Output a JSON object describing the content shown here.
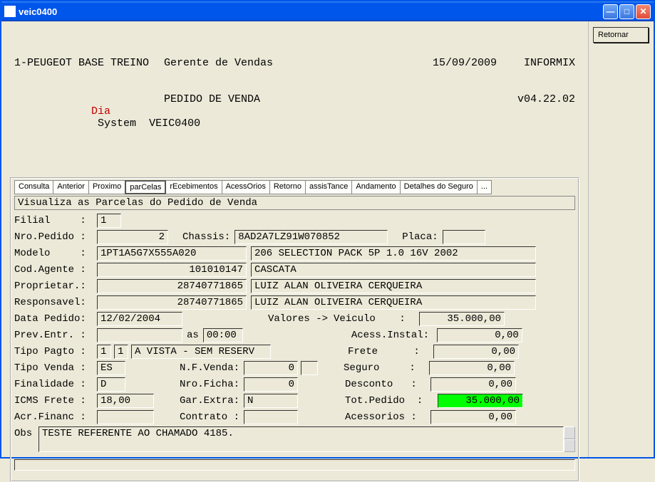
{
  "window": {
    "title": "veic0400"
  },
  "header": {
    "org": "1-PEUGEOT BASE TREINO",
    "role": "Gerente de Vendas",
    "date": "15/09/2009",
    "db": "INFORMIX",
    "dia": "Dia",
    "system_lbl": "System",
    "system_code": "VEIC0400",
    "screen_title": "PEDIDO DE VENDA",
    "version": "v04.22.02"
  },
  "tabs": {
    "consulta": "Consulta",
    "anterior": "Anterior",
    "proximo": "Proximo",
    "parcelas": "parCelas",
    "recebimentos": "rEcebimentos",
    "acessorios": "AcessOrios",
    "retorno": "Retorno",
    "assistance": "assisTance",
    "andamento": "Andamento",
    "detalhes": "Detalhes do Seguro",
    "more": "..."
  },
  "desc": "Visualiza as Parcelas do Pedido de Venda",
  "labels": {
    "filial": "Filial     :",
    "nro_pedido": "Nro.Pedido :",
    "chassis": "Chassis:",
    "placa": "Placa:",
    "modelo": "Modelo     :",
    "cod_agente": "Cod.Agente :",
    "proprietar": "Proprietar.:",
    "responsavel": "Responsavel:",
    "data_pedido": "Data Pedido:",
    "valores": "Valores ->",
    "veiculo": "Veiculo    :",
    "prev_entr": "Prev.Entr. :",
    "as": "as",
    "acess_instal": "Acess.Instal:",
    "tipo_pagto": "Tipo Pagto :",
    "frete": "Frete      :",
    "tipo_venda": "Tipo Venda :",
    "nf_venda": "N.F.Venda:",
    "seguro": "Seguro     :",
    "finalidade": "Finalidade :",
    "nro_ficha": "Nro.Ficha:",
    "desconto": "Desconto   :",
    "icms_frete": "ICMS Frete :",
    "gar_extra": "Gar.Extra:",
    "tot_pedido": "Tot.Pedido  :",
    "acr_financ": "Acr.Financ :",
    "contrato": "Contrato :",
    "acessorios": "Acessorios :",
    "obs": "Obs"
  },
  "values": {
    "filial": "1",
    "nro_pedido": "2",
    "chassis": "8AD2A7LZ91W070852",
    "placa": "",
    "modelo_code": "1PT1A5G7X555A020",
    "modelo_desc": "206 SELECTION PACK 5P 1.0 16V 2002",
    "cod_agente": "101010147",
    "agente_name": "CASCATA",
    "proprietar_code": "28740771865",
    "proprietar_name": "LUIZ ALAN OLIVEIRA CERQUEIRA",
    "responsavel_code": "28740771865",
    "responsavel_name": "LUIZ ALAN OLIVEIRA CERQUEIRA",
    "data_pedido": "12/02/2004",
    "veiculo": "35.000,00",
    "prev_entr": "",
    "prev_entr_time": "00:00",
    "acess_instal": "0,00",
    "tipo_pagto_1": "1",
    "tipo_pagto_2": "1",
    "tipo_pagto_desc": "A VISTA - SEM RESERV",
    "frete": "0,00",
    "tipo_venda": "ES",
    "nf_venda": "0",
    "nf_venda_extra": "",
    "seguro": "0,00",
    "finalidade": "D",
    "nro_ficha": "0",
    "desconto": "0,00",
    "icms_frete": "18,00",
    "gar_extra": "N",
    "tot_pedido": "35.000,00",
    "acr_financ": "",
    "contrato": "",
    "acessorios": "0,00",
    "obs": "TESTE REFERENTE AO CHAMADO 4185."
  },
  "side": {
    "retornar": "Retornar"
  }
}
